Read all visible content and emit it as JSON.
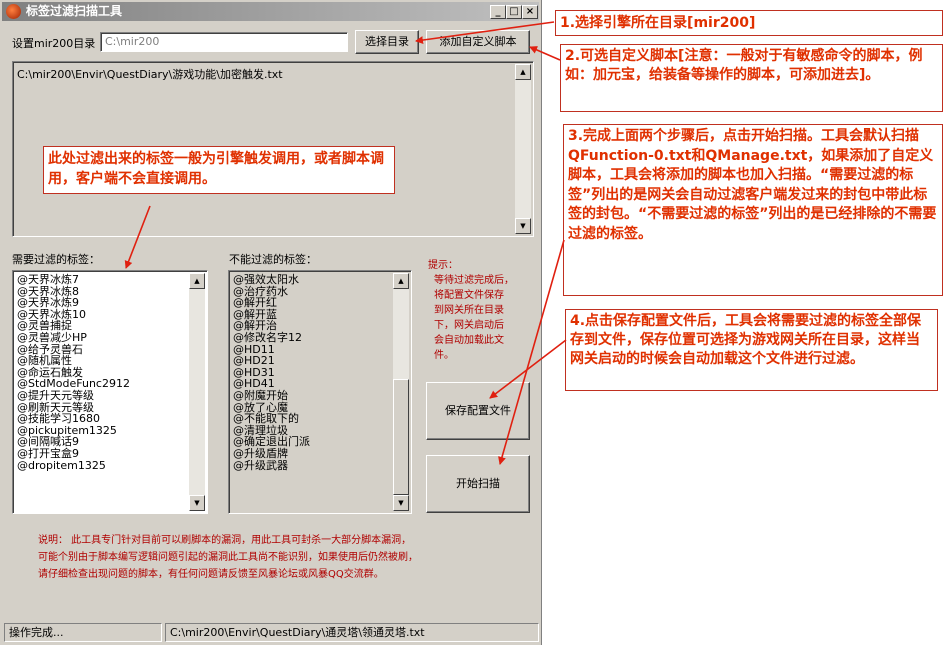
{
  "window": {
    "title": "标签过滤扫描工具",
    "title_buttons": {
      "minimize": "_",
      "maximize": "□",
      "close": "×"
    }
  },
  "toolbar": {
    "dir_label": "设置mir200目录",
    "dir_value": "C:\\mir200",
    "choose_dir_button": "选择目录",
    "add_script_button": "添加自定义脚本"
  },
  "script_memo": {
    "line": "C:\\mir200\\Envir\\QuestDiary\\游戏功能\\加密触发.txt"
  },
  "lists": {
    "needed_label": "需要过滤的标签：",
    "needed_items": [
      "@天界冰炼7",
      "@天界冰炼8",
      "@天界冰炼9",
      "@天界冰炼10",
      "@灵兽捕捉",
      "@灵兽减少HP",
      "@给予灵兽石",
      "@随机属性",
      "@命运石触发",
      "@StdModeFunc2912",
      "@提升天元等级",
      "@刷新天元等级",
      "@技能学习1680",
      "@pickupitem1325",
      "@间隔喊话9",
      "@打开宝盒9",
      "@dropitem1325"
    ],
    "not_needed_label": "不能过滤的标签：",
    "not_needed_items": [
      "@强效太阳水",
      "@治疗药水",
      "@解开红",
      "@解开蓝",
      "@解开治",
      "@修改名字12",
      "@HD11",
      "@HD21",
      "@HD31",
      "@HD41",
      "@附魔开始",
      "@放了心魔",
      "@不能取下的",
      "@清理垃圾",
      "@确定退出门派",
      "@升级盾牌",
      "@升级武器"
    ]
  },
  "hint": {
    "title": "提示：",
    "lines": [
      "等待过滤完成后，",
      "将配置文件保存",
      "到网关所在目录",
      "下，网关启动后",
      "会自动加载此文",
      "件。"
    ]
  },
  "actions": {
    "save_config_button": "保存配置文件",
    "start_scan_button": "开始扫描"
  },
  "footer_note": {
    "lines": [
      "说明：  此工具专门针对目前可以刷脚本的漏洞，用此工具可封杀一大部分脚本漏洞，",
      "可能个别由于脚本编写逻辑问题引起的漏洞此工具尚不能识别，如果使用后仍然被刷，",
      "请仔细检查出现问题的脚本，有任何问题请反馈至风暴论坛或风暴QQ交流群。"
    ]
  },
  "status": {
    "left": "操作完成...",
    "right": "C:\\mir200\\Envir\\QuestDiary\\通灵塔\\领通灵塔.txt"
  },
  "annotations": {
    "step1": "1.选择引擎所在目录[mir200]",
    "step2": "2.可选自定义脚本[注意：一般对于有敏感命令的脚本，例如：加元宝，给装备等操作的脚本，可添加进去]。",
    "step3": "3.完成上面两个步骤后，点击开始扫描。工具会默认扫描QFunction-0.txt和QManage.txt，如果添加了自定义脚本，工具会将添加的脚本也加入扫描。“需要过滤的标签”列出的是网关会自动过滤客户端发过来的封包中带此标签的封包。“不需要过滤的标签”列出的是已经排除的不需要过滤的标签。",
    "step4": "4.点击保存配置文件后，工具会将需要过滤的标签全部保存到文件，保存位置可选择为游戏网关所在目录，这样当网关启动的时候会自动加载这个文件进行过滤。",
    "filter_note": "此处过滤出来的标签一般为引擎触发调用，或者脚本调用，客户端不会直接调用。"
  },
  "colors": {
    "callout_text": "#e03000",
    "callout_border": "#c03020",
    "arrow": "#e02010",
    "hint_text": "#b00000",
    "window_face": "#d4d0c8"
  }
}
